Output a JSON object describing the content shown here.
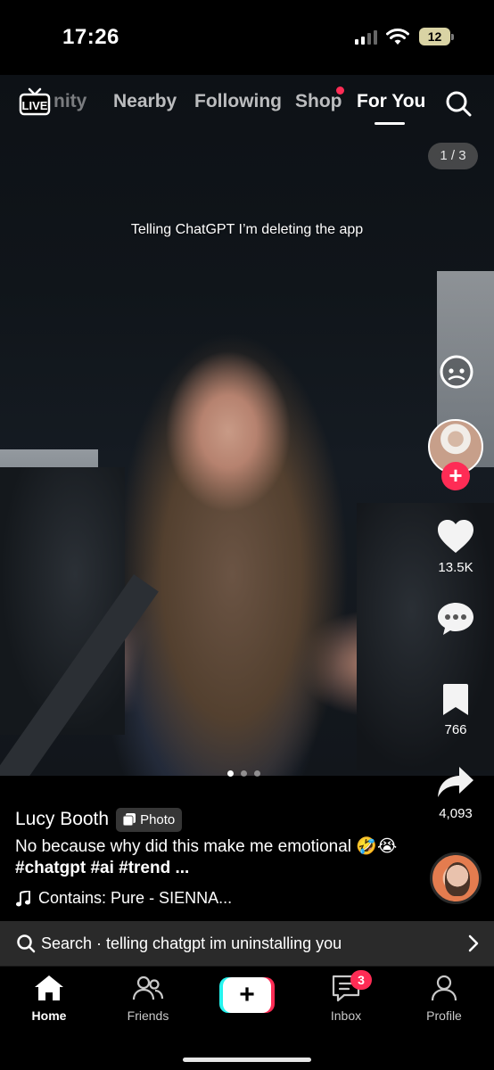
{
  "status_bar": {
    "time": "17:26",
    "battery": "12"
  },
  "top_nav": {
    "live_label": "LIVE",
    "tabs": [
      {
        "label": "nity"
      },
      {
        "label": "Nearby"
      },
      {
        "label": "Following"
      },
      {
        "label": "Shop"
      },
      {
        "label": "For You"
      }
    ],
    "active_tab": "For You"
  },
  "post": {
    "page_indicator": "1 / 3",
    "overlay_text": "Telling ChatGPT I’m deleting the app",
    "slide_count": 3,
    "active_slide": 1,
    "author": "Lucy Booth",
    "badge": "Photo",
    "description_text": "No because why did this make me emotional 🤣😭",
    "description_tags": "#chatgpt #ai #trend ...",
    "music": "Contains: Pure - SIENNA..."
  },
  "actions": {
    "likes": "13.5K",
    "bookmarks": "766",
    "shares": "4,093"
  },
  "search_bar": {
    "text": "Search · telling chatgpt im uninstalling you"
  },
  "bottom_nav": {
    "home": "Home",
    "friends": "Friends",
    "create": "+",
    "inbox": "Inbox",
    "inbox_badge": "3",
    "profile": "Profile"
  },
  "colors": {
    "accent_red": "#fe2c55",
    "accent_cyan": "#25f4ee",
    "background": "#000000"
  }
}
